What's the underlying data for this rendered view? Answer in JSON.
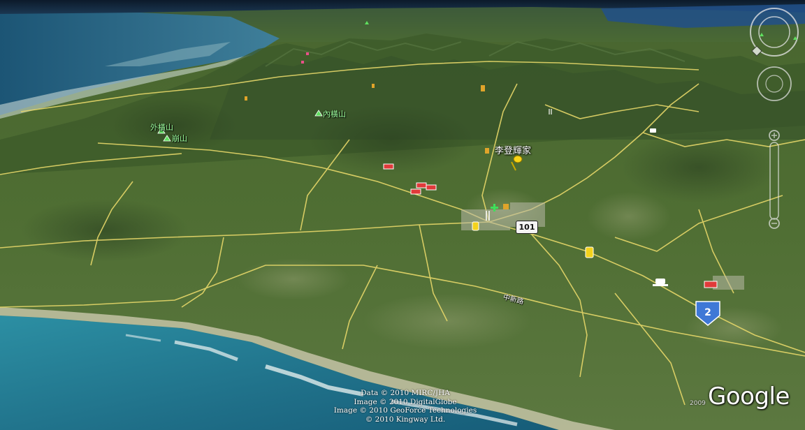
{
  "place_labels": {
    "li_residence": "李登輝家",
    "outer_peak": "外橫山",
    "inner_peak": "內橫山",
    "south_peak": "崩山"
  },
  "road_labels": {
    "coastal_road": "中新路"
  },
  "highway_signs": {
    "route_101": "101",
    "route_2": "2"
  },
  "attribution": {
    "line1": "Data © 2010 MIRC/JHA",
    "line2": "Image © 2010 DigitalGlobe",
    "line3": "Image © 2010 GeoForce Technologies",
    "line4": "© 2010 Kingway Ltd."
  },
  "branding": {
    "logo": "Google",
    "year": "2009"
  },
  "icons": [
    "peak-icon",
    "placemark-pushpin-icon",
    "hotel-icon",
    "gas-station-icon",
    "restaurant-icon",
    "cafe-icon",
    "hospital-icon",
    "highway-shield-icon",
    "compass-icon",
    "look-joystick-icon",
    "move-joystick-icon",
    "zoom-slider-icon"
  ],
  "colors": {
    "ocean": "#2f8a9e",
    "land": "#4d6b32",
    "road": "#e8d86a",
    "peak_marker": "#5fe05f",
    "pushpin": "#f7d417",
    "shield": "#3e78d6"
  }
}
